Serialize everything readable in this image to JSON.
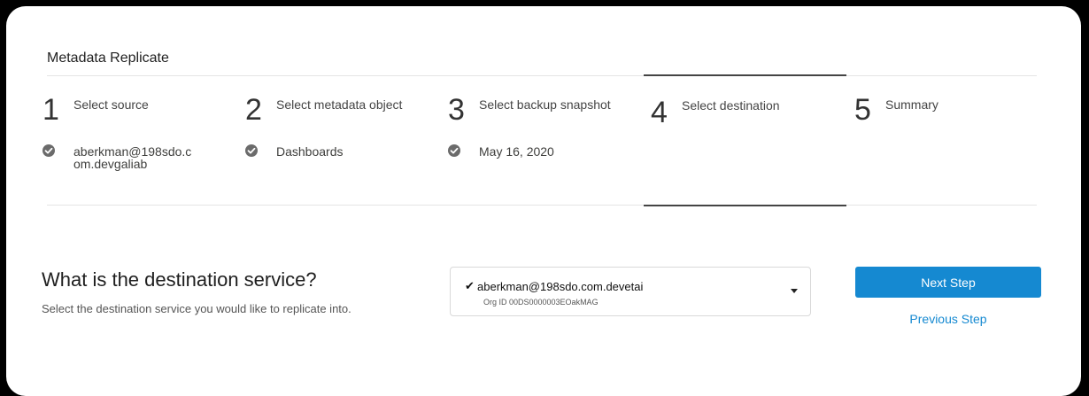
{
  "page": {
    "title": "Metadata Replicate"
  },
  "steps": [
    {
      "number": "1",
      "label": "Select source",
      "value": "aberkman@198sdo.com.devgaliab"
    },
    {
      "number": "2",
      "label": "Select metadata object",
      "value": "Dashboards"
    },
    {
      "number": "3",
      "label": "Select backup snapshot",
      "value": "May 16, 2020"
    },
    {
      "number": "4",
      "label": "Select destination"
    },
    {
      "number": "5",
      "label": "Summary"
    }
  ],
  "destination": {
    "question": "What is the destination service?",
    "subtitle": "Select the destination service you would like to replicate into.",
    "selected_check": "✔",
    "selected_email": "aberkman@198sdo.com.devetai",
    "selected_org": "Org ID 00DS0000003EOakMAG"
  },
  "actions": {
    "next_label": "Next Step",
    "prev_label": "Previous Step"
  },
  "colors": {
    "accent": "#1589d1",
    "check": "#6b6b6b"
  }
}
